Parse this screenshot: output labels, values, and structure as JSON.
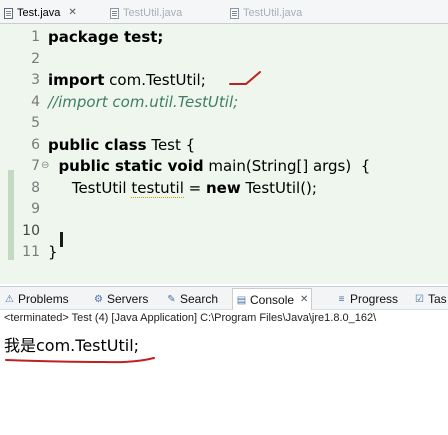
{
  "editor_tabs": [
    {
      "label": "Test.java",
      "active": true,
      "close": "✕"
    },
    {
      "label": "TestUtil.java",
      "active": false
    },
    {
      "label": "TestUtil.java",
      "active": false
    }
  ],
  "code_lines": [
    {
      "num": "1",
      "fold": "",
      "segments": [
        {
          "t": "package test;",
          "c": "kw"
        }
      ]
    },
    {
      "num": "2",
      "fold": "",
      "segments": []
    },
    {
      "num": "3",
      "fold": "",
      "segments": [
        {
          "t": "import",
          "c": "kw"
        },
        {
          "t": " com.TestUtil;",
          "c": ""
        }
      ]
    },
    {
      "num": "4",
      "fold": "",
      "segments": [
        {
          "t": "//import com.util.TestUtil;",
          "c": "cm"
        }
      ]
    },
    {
      "num": "5",
      "fold": "",
      "segments": []
    },
    {
      "num": "6",
      "fold": "",
      "segments": [
        {
          "t": "public class",
          "c": "kw"
        },
        {
          "t": " Test {",
          "c": ""
        }
      ]
    },
    {
      "num": "7",
      "fold": "⊖",
      "segments": [
        {
          "t": "  public static void",
          "c": "kw"
        },
        {
          "t": " main(String[] args)  {",
          "c": ""
        }
      ]
    },
    {
      "num": "8",
      "fold": "",
      "segments": [
        {
          "t": "     TestUtil ",
          "c": ""
        },
        {
          "t": "testutil",
          "c": "warn"
        },
        {
          "t": " = ",
          "c": ""
        },
        {
          "t": "new",
          "c": "kw"
        },
        {
          "t": " TestUtil();",
          "c": ""
        }
      ]
    },
    {
      "num": "9",
      "fold": "",
      "segments": []
    },
    {
      "num": "10",
      "fold": "",
      "segments": [
        {
          "t": "  ",
          "c": ""
        }
      ]
    },
    {
      "num": "11",
      "fold": "",
      "segments": [
        {
          "t": "}",
          "c": ""
        }
      ]
    }
  ],
  "views": {
    "tabs": [
      {
        "label": "Problems",
        "icon": "problems-icon",
        "glyph": "⚠",
        "active": false
      },
      {
        "label": "Servers",
        "icon": "servers-icon",
        "glyph": "⚙",
        "active": false
      },
      {
        "label": "Search",
        "icon": "search-icon",
        "glyph": "✎",
        "active": false
      },
      {
        "label": "Console",
        "icon": "console-icon",
        "glyph": "▤",
        "active": true,
        "close": "✕"
      },
      {
        "label": "Progress",
        "icon": "progress-icon",
        "glyph": "≡",
        "active": false
      },
      {
        "label": "Tas",
        "icon": "tasks-icon",
        "glyph": "☑",
        "active": false
      }
    ]
  },
  "console": {
    "terminated": "<terminated> Test (4) [Java Application] C:\\Program Files\\Java\\jre1.8.0_162\\",
    "output": "我是com.TestUtil;"
  },
  "colors": {
    "editor_bg": "#eef6ee",
    "annotation_red": "#c02020",
    "keyword": "#000000",
    "comment": "#3f7f5f"
  }
}
